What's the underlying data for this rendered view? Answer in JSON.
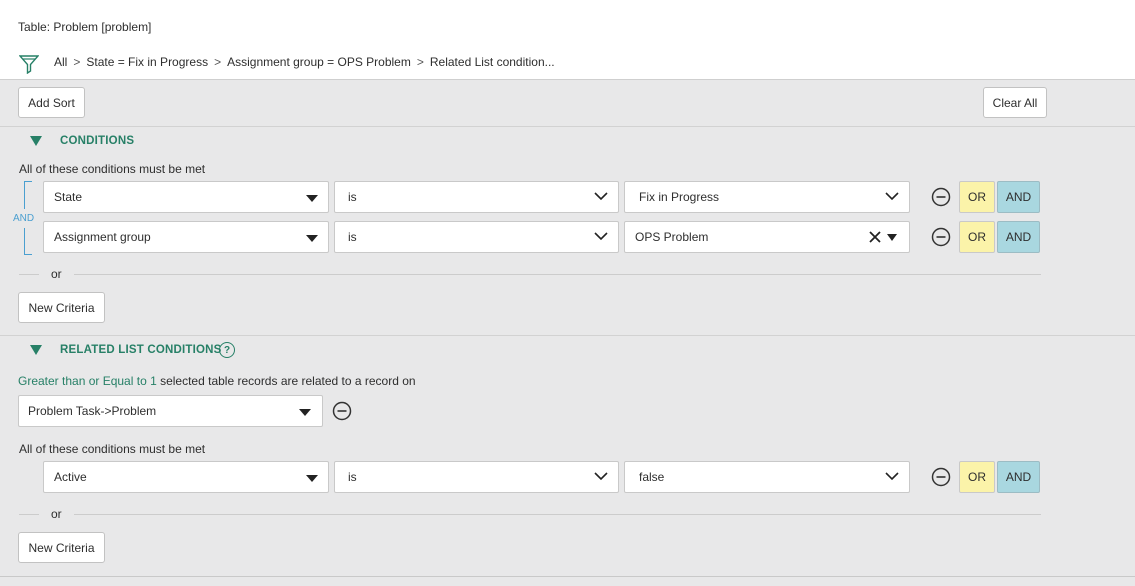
{
  "header": {
    "table_title": "Table: Problem [problem]",
    "breadcrumbs": [
      "All",
      "State = Fix in Progress",
      "Assignment group = OPS Problem",
      "Related List condition..."
    ],
    "separator": ">"
  },
  "toolbar": {
    "add_sort": "Add Sort",
    "clear_all": "Clear All"
  },
  "conditions": {
    "title": "CONDITIONS",
    "note": "All of these conditions must be met",
    "and_label": "AND",
    "rows": [
      {
        "field": "State",
        "operator": "is",
        "value": "Fix in Progress"
      },
      {
        "field": "Assignment group",
        "operator": "is",
        "value": "OPS Problem"
      }
    ],
    "or_label": "or",
    "new_criteria": "New Criteria"
  },
  "related": {
    "title": "RELATED LIST CONDITIONS",
    "help": "?",
    "quantity_link": "Greater than or Equal to 1",
    "quantity_rest": " selected table records are related to a record on",
    "related_table": "Problem Task->Problem",
    "note": "All of these conditions must be met",
    "rows": [
      {
        "field": "Active",
        "operator": "is",
        "value": "false"
      }
    ],
    "or_label": "or",
    "new_criteria": "New Criteria"
  },
  "buttons": {
    "or": "OR",
    "and": "AND"
  },
  "colors": {
    "accent": "#278067",
    "or_bg": "#fbf3a9",
    "and_bg": "#a9d7e0",
    "panel_bg": "#e8e8e9"
  }
}
